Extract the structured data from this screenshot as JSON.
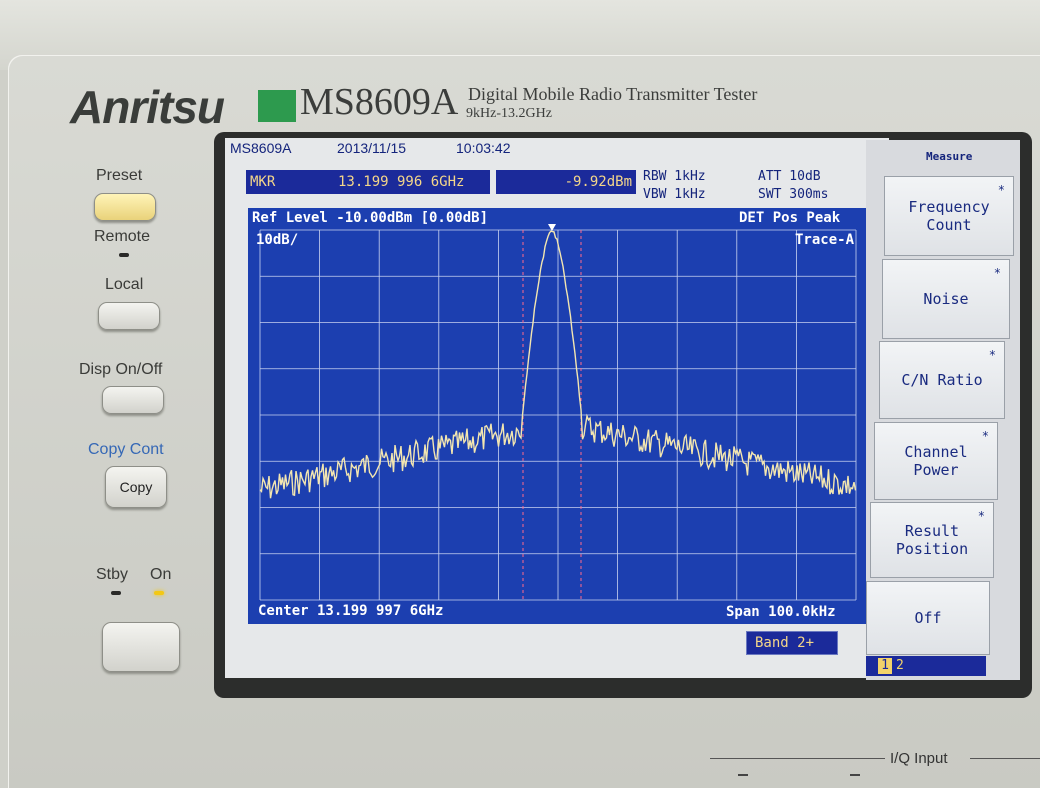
{
  "brand": {
    "name": "Anritsu",
    "model": "MS8609A",
    "description": "Digital Mobile Radio Transmitter Tester",
    "range": "9kHz-13.2GHz"
  },
  "front_panel": {
    "preset_label": "Preset",
    "remote_label": "Remote",
    "local_label": "Local",
    "disp_label": "Disp On/Off",
    "copy_cont_label": "Copy Cont",
    "copy_button": "Copy",
    "stby_label": "Stby",
    "on_label": "On",
    "iq_input_label": "I/Q Input"
  },
  "screen": {
    "model": "MS8609A",
    "date": "2013/11/15",
    "time": "10:03:42",
    "marker_label": "MKR",
    "marker_freq": "13.199 996 6GHz",
    "marker_level": "-9.92dBm",
    "rbw": "RBW 1kHz",
    "vbw": "VBW 1kHz",
    "att": "ATT 10dB",
    "swt": "SWT 300ms",
    "ref_level": "Ref Level -10.00dBm [0.00dB]",
    "det": "DET  Pos Peak",
    "scale": "10dB/",
    "trace": "Trace-A",
    "center": "Center 13.199 997 6GHz",
    "span": "Span 100.0kHz",
    "band": "Band 2+"
  },
  "softkeys": {
    "title": "Measure",
    "items": [
      {
        "label1": "Frequency",
        "label2": "Count",
        "star": "*"
      },
      {
        "label1": "Noise",
        "label2": "",
        "star": "*"
      },
      {
        "label1": "C/N Ratio",
        "label2": "",
        "star": "*"
      },
      {
        "label1": "Channel",
        "label2": "Power",
        "star": "*"
      },
      {
        "label1": "Result",
        "label2": "Position",
        "star": "*"
      },
      {
        "label1": "Off",
        "label2": "",
        "star": ""
      }
    ],
    "page_1": "1",
    "page_2": "2"
  },
  "colors": {
    "graph_bg": "#1c3fb0",
    "trace": "#f3e6b0",
    "grid": "#c8d2f0",
    "marker_lines": "#ff6a8a"
  }
}
